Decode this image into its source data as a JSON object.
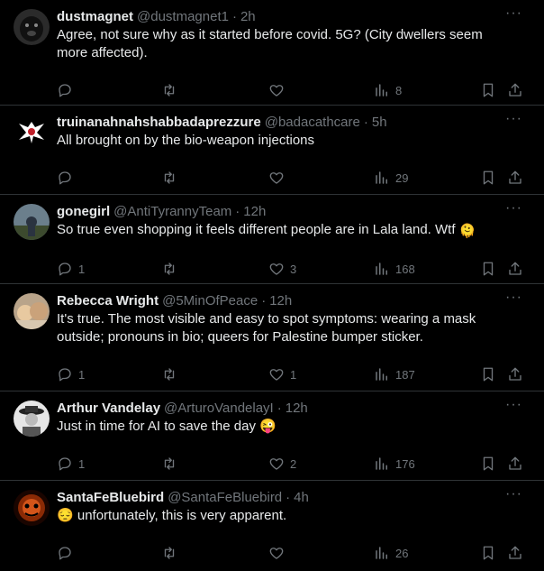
{
  "tweets": [
    {
      "name": "dustmagnet",
      "handle": "@dustmagnet1",
      "time": "2h",
      "text_lines": [
        "Agree, not sure why as it started before covid.  5G? (City dwellers seem",
        "more affected)."
      ],
      "replies": "",
      "likes": "",
      "views": "8",
      "avatar_color": "#3a3a3a"
    },
    {
      "name": "truinanahnahshabbadaprezzure",
      "handle": "@badacathcare",
      "time": "5h",
      "text_lines": [
        "All brought on by the bio-weapon injections"
      ],
      "replies": "",
      "likes": "",
      "views": "29",
      "avatar_color": "#000000"
    },
    {
      "name": "gonegirl",
      "handle": "@AntiTyrannyTeam",
      "time": "12h",
      "text_lines": [
        "So true even shopping it feels different people are in Lala land. Wtf"
      ],
      "emoji_end": "🫠",
      "replies": "1",
      "likes": "3",
      "views": "168",
      "avatar_color": "#5a6e7a"
    },
    {
      "name": "Rebecca Wright",
      "handle": "@5MinOfPeace",
      "time": "12h",
      "text_lines": [
        "It's true.  The most visible and easy to spot symptoms: wearing a mask",
        "outside; pronouns in bio; queers for Palestine bumper sticker."
      ],
      "replies": "1",
      "likes": "1",
      "views": "187",
      "avatar_color": "#c9a07a"
    },
    {
      "name": "Arthur Vandelay",
      "handle": "@ArturoVandelayI",
      "time": "12h",
      "text_lines": [
        "Just in time for AI to save the day"
      ],
      "emoji_end": "😜",
      "replies": "1",
      "likes": "2",
      "views": "176",
      "avatar_color": "#d0d0d0"
    },
    {
      "name": "SantaFeBluebird",
      "handle": "@SantaFeBluebird",
      "time": "4h",
      "emoji_start": "😔",
      "text_lines": [
        "unfortunately, this is very apparent."
      ],
      "replies": "",
      "likes": "",
      "views": "26",
      "avatar_color": "#7a2a0a"
    }
  ],
  "separator_dot": "·",
  "more_label": "···"
}
